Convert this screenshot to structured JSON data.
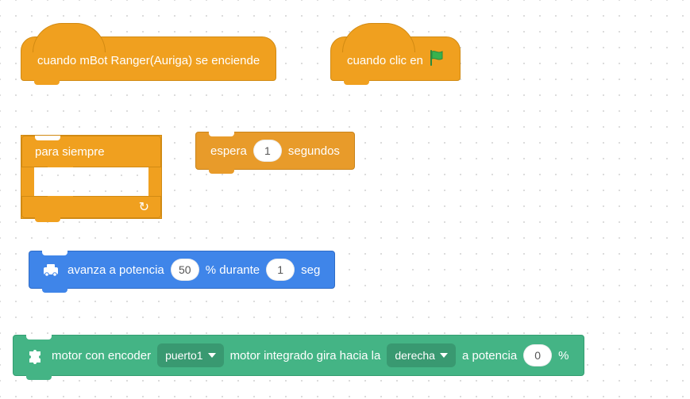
{
  "hat1": {
    "label": "cuando mBot Ranger(Auriga) se enciende"
  },
  "hat2": {
    "label_pre": "cuando clic en",
    "flag_icon": "green-flag-icon"
  },
  "forever": {
    "label": "para siempre",
    "loop_icon": "loop-arrow-icon"
  },
  "wait": {
    "pre": "espera",
    "value": "1",
    "post": "segundos"
  },
  "move": {
    "icon": "robot-icon",
    "pre": "avanza a potencia",
    "power": "50",
    "mid": "% durante",
    "secs": "1",
    "post": "seg"
  },
  "motor": {
    "icon": "puzzle-icon",
    "t1": "motor con encoder",
    "port": "puerto1",
    "t2": "motor integrado",
    "t3": "gira",
    "t4": "hacia la",
    "dir": "derecha",
    "t5": "a potencia",
    "power": "0",
    "t6": "%"
  }
}
